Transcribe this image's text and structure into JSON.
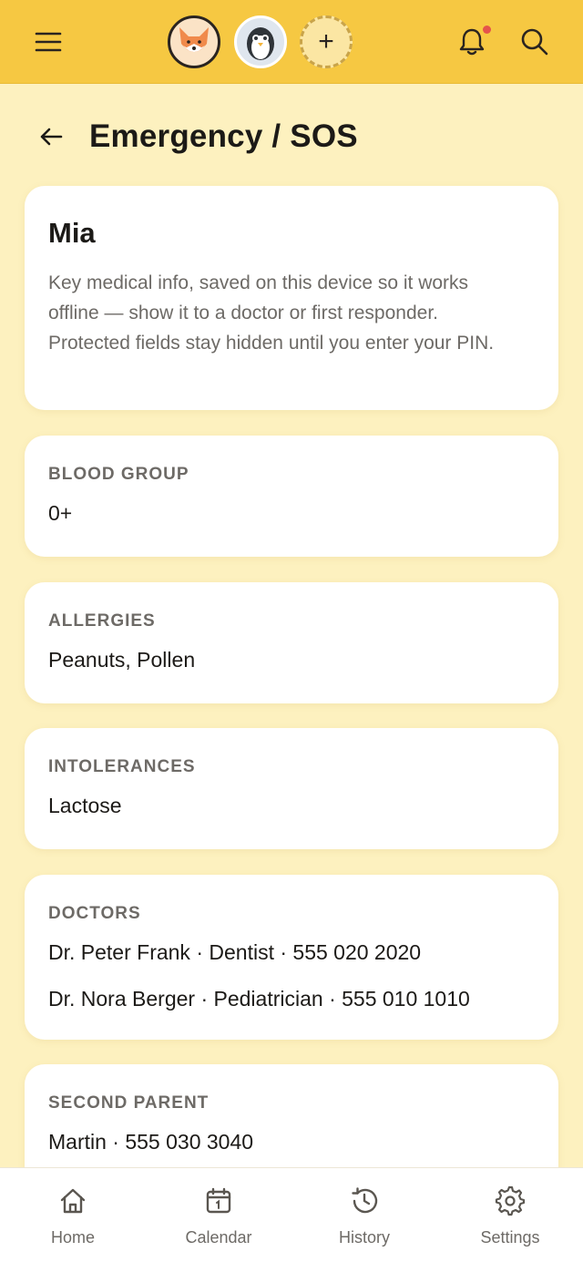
{
  "header": {
    "menu_icon": "menu-icon",
    "notification_icon": "bell-icon",
    "search_icon": "search-icon",
    "notification_dot_color": "#e5534b",
    "background_color": "#f6c842",
    "profiles": [
      {
        "icon": "fox-avatar"
      },
      {
        "icon": "penguin-avatar"
      }
    ],
    "add_profile_label": "+"
  },
  "page": {
    "back_icon": "arrow-left-icon",
    "title": "Emergency / SOS"
  },
  "intro": {
    "name": "Mia",
    "description": "Key medical info, saved on this device so it works offline — show it to a doctor or first responder. Protected fields stay hidden until you enter your PIN."
  },
  "fields": {
    "blood_group": {
      "label": "BLOOD GROUP",
      "value": "0+"
    },
    "allergies": {
      "label": "ALLERGIES",
      "value": "Peanuts, Pollen"
    },
    "intolerances": {
      "label": "INTOLERANCES",
      "value": "Lactose"
    },
    "doctors": {
      "label": "DOCTORS",
      "entries": [
        "Dr. Peter Frank · Dentist · 555 020 2020",
        "Dr. Nora Berger · Pediatrician · 555 010 1010"
      ]
    },
    "second_parent": {
      "label": "SECOND PARENT",
      "value": "Martin · 555 030 3040"
    }
  },
  "bottom_nav": [
    {
      "label": "Home",
      "icon": "home-icon"
    },
    {
      "label": "Calendar",
      "icon": "calendar-icon"
    },
    {
      "label": "History",
      "icon": "history-icon"
    },
    {
      "label": "Settings",
      "icon": "gear-icon"
    }
  ]
}
